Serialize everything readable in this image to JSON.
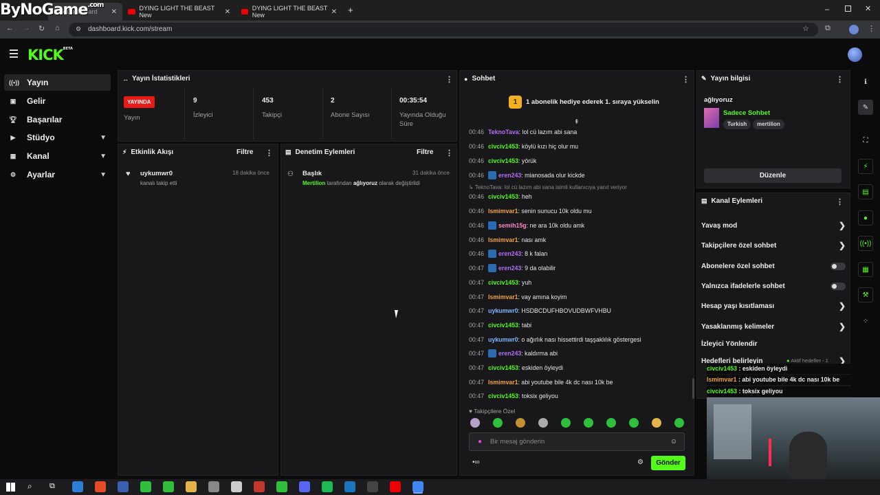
{
  "watermark": "ByNoGame",
  "watermark_suffix": ".com",
  "browser": {
    "tabs": [
      {
        "label": "Kick Dashboard"
      },
      {
        "label": "DYING LIGHT THE BEAST New"
      },
      {
        "label": "DYING LIGHT THE BEAST New"
      }
    ],
    "url": "dashboard.kick.com/stream"
  },
  "brand": {
    "logo": "KICK",
    "tag": "BETA",
    "color": "#53fc18"
  },
  "sidebar": {
    "items": [
      {
        "label": "Yayın",
        "icon": "broadcast-icon"
      },
      {
        "label": "Gelir",
        "icon": "revenue-icon"
      },
      {
        "label": "Başarılar",
        "icon": "trophy-icon"
      },
      {
        "label": "Stüdyo",
        "icon": "studio-icon",
        "expandable": true
      },
      {
        "label": "Kanal",
        "icon": "channel-icon",
        "expandable": true
      },
      {
        "label": "Ayarlar",
        "icon": "settings-icon",
        "expandable": true
      }
    ]
  },
  "stats": {
    "title": "Yayın İstatistikleri",
    "status_badge": "YAYINDA",
    "status_label": "Yayın",
    "viewers_value": "9",
    "viewers_label": "İzleyici",
    "followers_value": "453",
    "followers_label": "Takipçi",
    "subs_value": "2",
    "subs_label": "Abone Sayısı",
    "uptime_value": "00:35:54",
    "uptime_label_1": "Yayında Olduğu",
    "uptime_label_2": "Süre"
  },
  "activity": {
    "title": "Etkinlik Akışı",
    "filter": "Filtre",
    "items": [
      {
        "user": "uykumwr0",
        "desc": "kanalı takip etti",
        "time": "18 dakika önce"
      }
    ]
  },
  "moderation": {
    "title": "Denetim Eylemleri",
    "filter": "Filtre",
    "items": [
      {
        "title": "Başlık",
        "actor": "Mertilion",
        "mid": "tarafından",
        "target": "ağlıyoruz",
        "tail": "olarak değiştirildi",
        "time": "31 dakika önce"
      }
    ]
  },
  "chat": {
    "title": "Sohbet",
    "pinned_count": "1",
    "pinned_text": "1 abonelik hediye ederek 1. sıraya yükselin",
    "reply_note": "TeknoTava: lol cü lazım abi sana isimli kullanıcıya yanıt veriyor",
    "messages": [
      {
        "t": "00:46",
        "user": "TeknoTava",
        "color": "purple",
        "badge": false,
        "text": ": lol cü lazım abi sana"
      },
      {
        "t": "00:46",
        "user": "civciv1453",
        "color": "green",
        "badge": false,
        "text": ": köylü kızı hiç olur mu"
      },
      {
        "t": "00:46",
        "user": "civciv1453",
        "color": "green",
        "badge": false,
        "text": ": yörük"
      },
      {
        "t": "00:46",
        "user": "eren243",
        "color": "purple",
        "badge": true,
        "text": ": mianosada olur kickde"
      },
      {
        "t": "00:46",
        "user": "civciv1453",
        "color": "green",
        "badge": false,
        "text": ": heh"
      },
      {
        "t": "00:46",
        "user": "Ismimvar1",
        "color": "orange",
        "badge": false,
        "text": ": senin sunucu 10k oldu mu"
      },
      {
        "t": "00:46",
        "user": "semih15g",
        "color": "pink",
        "badge": true,
        "text": ": ne ara 10k oldu amk"
      },
      {
        "t": "00:46",
        "user": "Ismimvar1",
        "color": "orange",
        "badge": false,
        "text": ": nası amk"
      },
      {
        "t": "00:46",
        "user": "eren243",
        "color": "purple",
        "badge": true,
        "text": ": 8 k falan"
      },
      {
        "t": "00:47",
        "user": "eren243",
        "color": "purple",
        "badge": true,
        "text": ": 9 da olabilir"
      },
      {
        "t": "00:47",
        "user": "civciv1453",
        "color": "green",
        "badge": false,
        "text": ": yuh"
      },
      {
        "t": "00:47",
        "user": "Ismimvar1",
        "color": "orange",
        "badge": false,
        "text": ": vay amına koyim"
      },
      {
        "t": "00:47",
        "user": "uykumwr0",
        "color": "blue",
        "badge": false,
        "text": ": HSDBCDUFHBOVUDBWFVHBU"
      },
      {
        "t": "00:47",
        "user": "civciv1453",
        "color": "green",
        "badge": false,
        "text": ": tabi"
      },
      {
        "t": "00:47",
        "user": "uykumwr0",
        "color": "blue",
        "badge": false,
        "text": ": o ağırlık nası hissettirdi taşşaklılık göstergesi"
      },
      {
        "t": "00:47",
        "user": "eren243",
        "color": "purple",
        "badge": true,
        "text": ": kaldırma abi"
      },
      {
        "t": "00:47",
        "user": "civciv1453",
        "color": "green",
        "badge": false,
        "text": ": eskiden öyleydi"
      },
      {
        "t": "00:47",
        "user": "Ismimvar1",
        "color": "orange",
        "badge": false,
        "text": ": abi youtube bile 4k dc nası 10k be"
      },
      {
        "t": "00:47",
        "user": "civciv1453",
        "color": "green",
        "badge": false,
        "text": ": toksix geliyou"
      }
    ],
    "followers_only": "Takipçilere Özel",
    "input_placeholder": "Bir mesaj gönderin",
    "send_label": "Gönder"
  },
  "stream_info": {
    "title": "Yayın bilgisi",
    "stream_title": "ağlıyoruz",
    "category": "Sadece Sohbet",
    "tags": [
      "Turkish",
      "mertilion"
    ],
    "edit_label": "Düzenle"
  },
  "channel_actions": {
    "title": "Kanal Eylemleri",
    "rows": [
      {
        "label": "Yavaş mod",
        "kind": "arrow"
      },
      {
        "label": "Takipçilere özel sohbet",
        "kind": "arrow"
      },
      {
        "label": "Abonelere özel sohbet",
        "kind": "toggle"
      },
      {
        "label": "Yalnızca ifadelerle sohbet",
        "kind": "toggle"
      },
      {
        "label": "Hesap yaşı kısıtlaması",
        "kind": "arrow"
      },
      {
        "label": "Yasaklanmış kelimeler",
        "kind": "arrow"
      },
      {
        "label": "İzleyici Yönlendir",
        "kind": "none"
      },
      {
        "label": "Hedefleri belirleyin",
        "kind": "arrow"
      }
    ],
    "goals_note": "Aktif hedefler - 1"
  },
  "overlay_chat": [
    {
      "user": "civciv1453",
      "text": " : eskiden öyleydi",
      "color": "green"
    },
    {
      "user": "Ismimvar1",
      "text": " : abi youtube bile 4k dc nası 10k be",
      "color": "orange"
    },
    {
      "user": "civciv1453",
      "text": " : toksix geliyou",
      "color": "green"
    }
  ]
}
